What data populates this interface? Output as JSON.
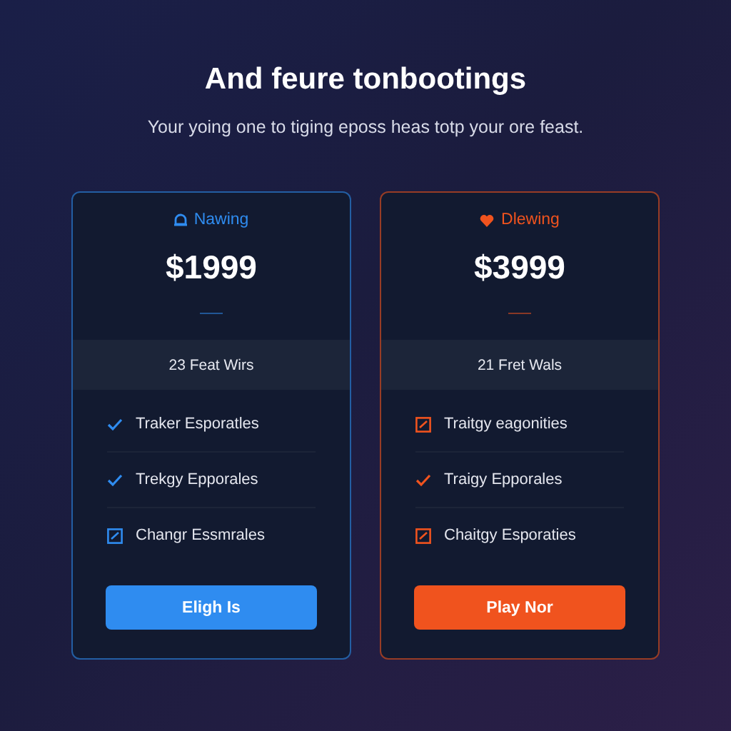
{
  "title": "And feure tonbootings",
  "subtitle": "Your yoing one to tiging eposs heas totp your ore feast.",
  "plans": [
    {
      "name": "Nawing",
      "kind": "bell",
      "color": "#2f8cf0",
      "price": "$1999",
      "summary": "23 Feat Wirs",
      "features": [
        {
          "kind": "check",
          "label": "Traker Esporatles"
        },
        {
          "kind": "check",
          "label": "Trekgy Epporales"
        },
        {
          "kind": "box",
          "label": "Changr Essmrales"
        }
      ],
      "button": "Eligh Is"
    },
    {
      "name": "Dlewing",
      "kind": "heart",
      "color": "#f0531e",
      "price": "$3999",
      "summary": "21 Fret Wals",
      "features": [
        {
          "kind": "box",
          "label": "Traitgy eagonities"
        },
        {
          "kind": "check",
          "label": "Traigy Epporales"
        },
        {
          "kind": "box",
          "label": "Chaitgy Esporaties"
        }
      ],
      "button": "Play Nor"
    }
  ]
}
